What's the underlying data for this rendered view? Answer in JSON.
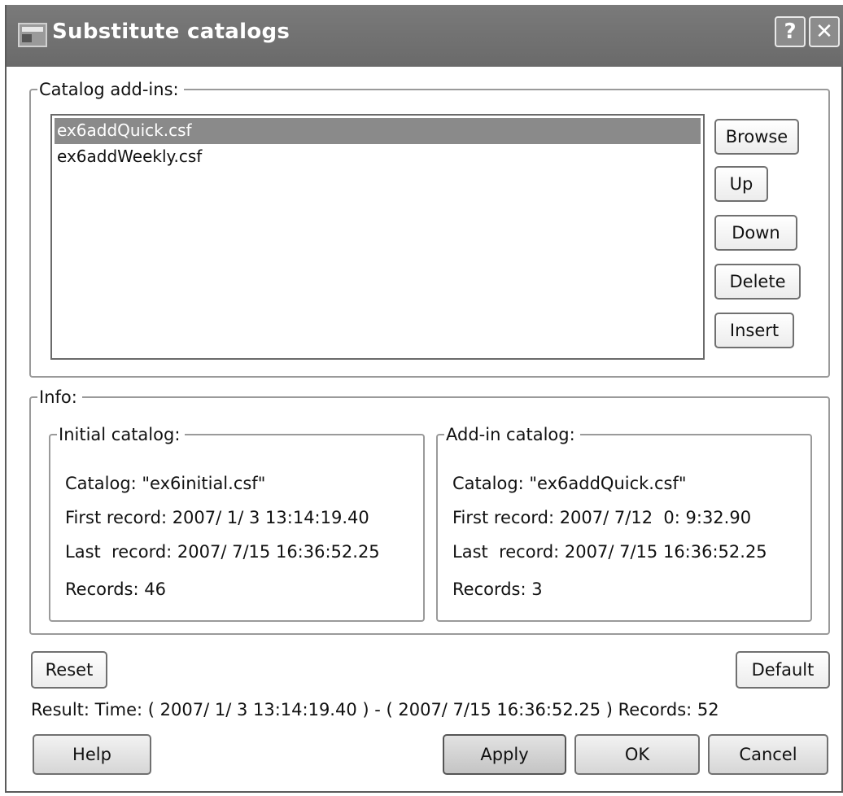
{
  "window": {
    "title": "Substitute catalogs",
    "help_label": "?",
    "close_label": "✕"
  },
  "addins": {
    "legend": "Catalog add-ins:",
    "items": [
      "ex6addQuick.csf",
      "ex6addWeekly.csf"
    ],
    "selected_index": 0,
    "buttons": {
      "browse": "Browse",
      "up": "Up",
      "down": "Down",
      "delete": "Delete",
      "insert": "Insert"
    }
  },
  "info": {
    "legend": "Info:",
    "initial": {
      "legend": "Initial catalog:",
      "catalog": "Catalog: \"ex6initial.csf\"",
      "first_record": "First record: 2007/ 1/ 3 13:14:19.40",
      "last_record": "Last  record: 2007/ 7/15 16:36:52.25",
      "records": "Records: 46"
    },
    "addin": {
      "legend": "Add-in catalog:",
      "catalog": "Catalog: \"ex6addQuick.csf\"",
      "first_record": "First record: 2007/ 7/12  0: 9:32.90",
      "last_record": "Last  record: 2007/ 7/15 16:36:52.25",
      "records": "Records: 3"
    }
  },
  "actions": {
    "reset": "Reset",
    "default": "Default",
    "result": "Result: Time: ( 2007/ 1/ 3 13:14:19.40 ) - ( 2007/ 7/15 16:36:52.25 ) Records: 52",
    "help": "Help",
    "apply": "Apply",
    "ok": "OK",
    "cancel": "Cancel"
  }
}
